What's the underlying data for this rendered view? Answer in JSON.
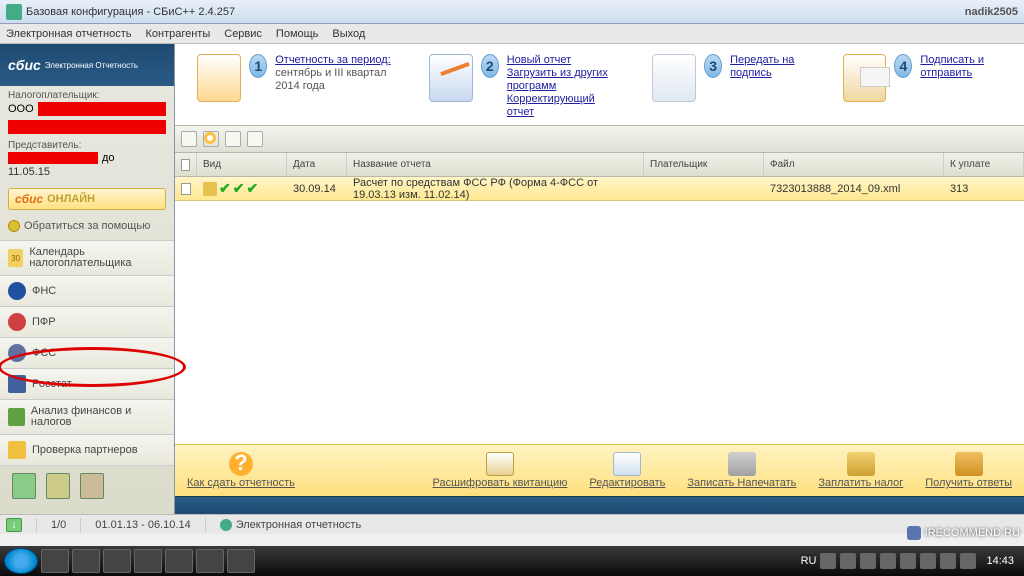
{
  "window": {
    "title": "Базовая конфигурация - СБиС++ 2.4.257",
    "user": "nadik2505"
  },
  "menu": [
    "Электронная отчетность",
    "Контрагенты",
    "Сервис",
    "Помощь",
    "Выход"
  ],
  "logo": {
    "main": "сбис",
    "sub": "Электронная\nОтчетность"
  },
  "taxpayer": {
    "label": "Налогоплательщик:",
    "prefix": "ООО"
  },
  "representative": {
    "label": "Представитель:",
    "suffix": "до",
    "date": "11.05.15"
  },
  "sbis_online": {
    "a": "сбис",
    "b": "ОНЛАЙН"
  },
  "help": "Обратиться за помощью",
  "nav": {
    "calendar": "Календарь налогоплательщика",
    "fns": "ФНС",
    "pfr": "ПФР",
    "fss": "ФСС",
    "rosstat": "Росстат",
    "analysis": "Анализ финансов и налогов",
    "check": "Проверка партнеров"
  },
  "steps": {
    "s1": {
      "num": "1",
      "title": "Отчетность за период:",
      "sub": "сентябрь и III квартал 2014 года"
    },
    "s2": {
      "num": "2",
      "l1": "Новый отчет",
      "l2": "Загрузить из других программ",
      "l3": "Корректирующий отчет"
    },
    "s3": {
      "num": "3",
      "l1": "Передать на подпись"
    },
    "s4": {
      "num": "4",
      "l1": "Подписать и отправить"
    }
  },
  "grid": {
    "headers": {
      "vid": "Вид",
      "date": "Дата",
      "name": "Название отчета",
      "payer": "Плательщик",
      "file": "Файл",
      "amt": "К уплате"
    },
    "row": {
      "date": "30.09.14",
      "name": "Расчет по средствам ФСС РФ (Форма 4-ФСС от 19.03.13 изм. 11.02.14)",
      "file": "7323013888_2014_09.xml",
      "amt": "313"
    }
  },
  "bottom": {
    "how": "Как сдать отчетность",
    "decode": "Расшифровать квитанцию",
    "edit": "Редактировать",
    "print": "Записать Напечатать",
    "pay": "Заплатить налог",
    "reply": "Получить ответы"
  },
  "status": {
    "pages": "1/0",
    "period": "01.01.13 - 06.10.14",
    "mode": "Электронная отчетность"
  },
  "tray": {
    "lang": "RU",
    "time": "14:43"
  },
  "watermark": "IRECOMMEND.RU"
}
